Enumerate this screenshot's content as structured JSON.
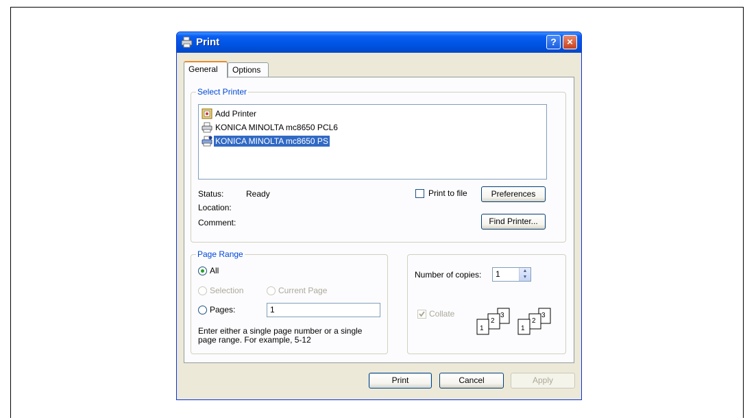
{
  "dialog": {
    "title": "Print",
    "help_label": "?",
    "close_label": "×"
  },
  "tabs": [
    {
      "label": "General",
      "active": true
    },
    {
      "label": "Options",
      "active": false
    }
  ],
  "select_printer": {
    "group_label": "Select Printer",
    "printers": [
      {
        "label": "Add Printer",
        "icon": "add-printer-icon",
        "selected": false
      },
      {
        "label": "KONICA MINOLTA mc8650 PCL6",
        "icon": "printer-icon",
        "selected": false
      },
      {
        "label": "KONICA MINOLTA mc8650 PS",
        "icon": "printer-icon",
        "selected": true
      }
    ],
    "status_label": "Status:",
    "status_value": "Ready",
    "location_label": "Location:",
    "comment_label": "Comment:",
    "print_to_file_label": "Print to file",
    "preferences_label": "Preferences",
    "find_printer_label": "Find Printer..."
  },
  "page_range": {
    "group_label": "Page Range",
    "all_label": "All",
    "selection_label": "Selection",
    "current_page_label": "Current Page",
    "pages_label": "Pages:",
    "pages_value": "1",
    "hint": "Enter either a single page number or a single",
    "hint2": "page range.  For example, 5-12"
  },
  "copies": {
    "label": "Number of copies:",
    "value": "1",
    "collate_label": "Collate",
    "collate_checked": true
  },
  "footer": {
    "print_label": "Print",
    "cancel_label": "Cancel",
    "apply_label": "Apply"
  },
  "colors": {
    "titlebar": "#0054e3",
    "selection": "#316ac5",
    "group_label": "#0046d5",
    "dialog_bg": "#ece9d8"
  }
}
